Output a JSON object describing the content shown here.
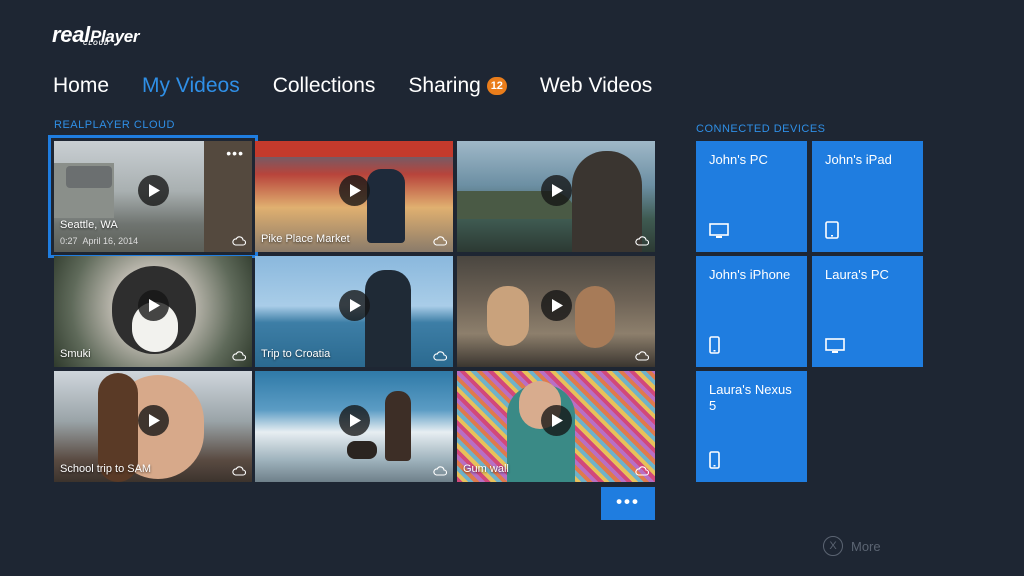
{
  "logo": {
    "prefix": "real",
    "name": "Player",
    "sub": "CLOUD"
  },
  "nav": [
    {
      "label": "Home",
      "active": false
    },
    {
      "label": "My Videos",
      "active": true
    },
    {
      "label": "Collections",
      "active": false
    },
    {
      "label": "Sharing",
      "active": false,
      "badge": "12"
    },
    {
      "label": "Web Videos",
      "active": false
    }
  ],
  "sections": {
    "videos": "REALPLAYER CLOUD",
    "devices": "CONNECTED DEVICES"
  },
  "videos": [
    {
      "title": "Seattle, WA",
      "duration": "0:27",
      "date": "April 16, 2014",
      "selected": true,
      "menu": "•••",
      "icon": "cloud-icon"
    },
    {
      "title": "Pike Place Market",
      "icon": "cloud-icon"
    },
    {
      "title": "",
      "icon": "cloud-icon"
    },
    {
      "title": "Smuki",
      "icon": "cloud-icon"
    },
    {
      "title": "Trip to Croatia",
      "icon": "cloud-icon"
    },
    {
      "title": "",
      "icon": "cloud-icon"
    },
    {
      "title": "School trip to SAM",
      "icon": "cloud-icon"
    },
    {
      "title": "",
      "icon": "cloud-icon"
    },
    {
      "title": "Gum wall",
      "icon": "cloud-icon"
    }
  ],
  "more_button": "•••",
  "devices": [
    {
      "name": "John's PC",
      "icon": "monitor-icon"
    },
    {
      "name": "John's iPad",
      "icon": "tablet-icon"
    },
    {
      "name": "John's iPhone",
      "icon": "phone-icon"
    },
    {
      "name": "Laura's PC",
      "icon": "monitor-icon"
    },
    {
      "name": "Laura's Nexus 5",
      "icon": "phone-icon"
    }
  ],
  "footer": {
    "button_glyph": "X",
    "label": "More"
  },
  "colors": {
    "background": "#1e2633",
    "accent": "#1f7de0",
    "badge": "#ea7d1b",
    "active_nav": "#2f8fe6"
  }
}
